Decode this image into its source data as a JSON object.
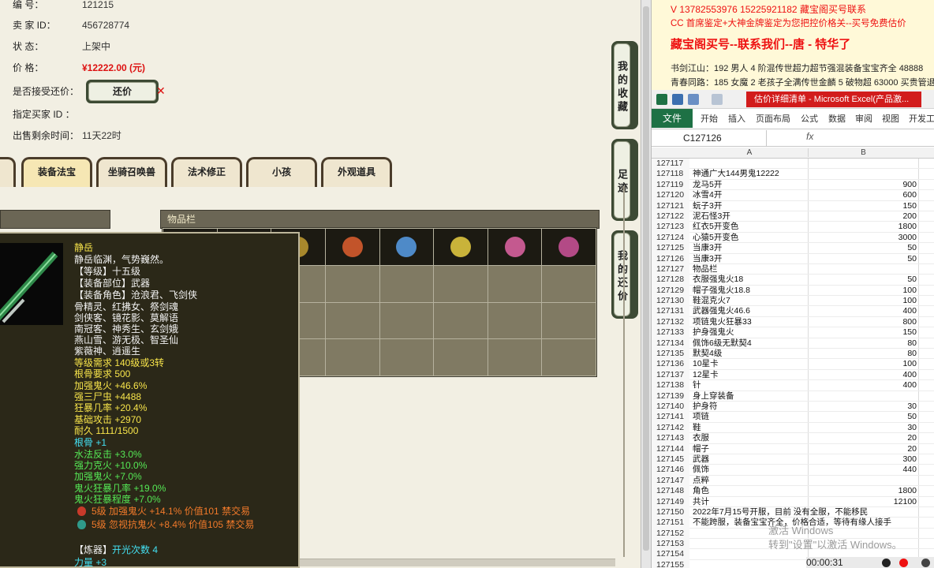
{
  "listing": {
    "serial_label": "编      号：",
    "serial_value": "121215",
    "seller_label": "卖  家  ID：",
    "seller_value": "456728774",
    "status_label": "状      态：",
    "status_value": "上架中",
    "price_label": "价      格：",
    "price_value": "¥12222.00 (元)",
    "counter_label": "是否接受还价：",
    "counter_button": "还价",
    "buyer_label": "指定买家 ID ：",
    "remaining_label": "出售剩余时间：",
    "remaining_value": "11天22时"
  },
  "tabs": [
    "装备法宝",
    "坐骑召唤兽",
    "法术修正",
    "小孩",
    "外观道具"
  ],
  "side_buttons": [
    "我的收藏",
    "足迹",
    "我的还价"
  ],
  "inventory_title": "物品栏",
  "item_colors": [
    "#3a6a3e",
    "#c9a040",
    "#a8882c",
    "#c2542a",
    "#4e8ac8",
    "#c9b33a",
    "#c4598f",
    "#b34a86"
  ],
  "tooltip": {
    "name": "静岳",
    "desc": "静岳临渊，气势巍然。",
    "level": "【等级】十五级",
    "slot": "【装备部位】武器",
    "roles": "【装备角色】沧浪君、飞剑侠",
    "roles_2": "骨精灵、红拂女、祭剑魂",
    "roles_3": "剑侠客、镜花影、莫解语",
    "roles_4": "南冠客、神秀生、玄剑娥",
    "roles_5": "燕山雪、游无极、智圣仙",
    "roles_6": "紫薇神、逍遥生",
    "req_level": "等级需求 140级或3转",
    "req_bone": "根骨要求 500",
    "stat_1": "加强鬼火 +46.6%",
    "stat_2": "强三尸虫 +4488",
    "stat_3": "狂暴几率 +20.4%",
    "stat_4": "基础攻击 +2970",
    "stat_5": "耐久 1111/1500",
    "bone": "根骨 +1",
    "bonus_1": "水法反击 +3.0%",
    "bonus_2": "强力克火 +10.0%",
    "bonus_3": "加强鬼火 +7.0%",
    "bonus_4": "鬼火狂暴几率 +19.0%",
    "bonus_5": "鬼火狂暴程度 +7.0%",
    "gem_1": "5级 加强鬼火 +14.1% 价值101 禁交易",
    "gem_2": "5级 忽视抗鬼火 +8.4% 价值105 禁交易",
    "refine_label": "【炼器】",
    "refine_value": "开光次数 4",
    "last_line": "力量 +3"
  },
  "ads": {
    "line_1": "V 13782553976     15225921182    藏宝阁买号联系",
    "line_2": "CC 首席鉴定+大神金牌鉴定为您把控价格关--买号免费估价",
    "line_3": "藏宝阁买号--联系我们--唐 - 特华了",
    "line_4": "书剑江山：192 男人 4 阶混传世超力超节强混装备宝宝齐全 48888",
    "line_5": "青春同路：185 女魔 2 老孩子全满传世金麟 5 破物超 63000 买贵管退"
  },
  "excel": {
    "title": "估价详细清单 - Microsoft Excel(产品激...",
    "file_tab": "文件",
    "ribbon_tabs": [
      "开始",
      "插入",
      "页面布局",
      "公式",
      "数据",
      "审阅",
      "视图",
      "开发工"
    ],
    "name_box": "C127126",
    "fx": "fx",
    "col_a": "A",
    "col_b": "B",
    "rows": [
      [
        "127117",
        "",
        ""
      ],
      [
        "127118",
        "神通广大144男鬼12222",
        ""
      ],
      [
        "127119",
        "龙马5开",
        "900"
      ],
      [
        "127120",
        "冰雪4开",
        "600"
      ],
      [
        "127121",
        "蚖子3开",
        "150"
      ],
      [
        "127122",
        "泥石怪3开",
        "200"
      ],
      [
        "127123",
        "红衣5开变色",
        "1800"
      ],
      [
        "127124",
        "心猿5开变色",
        "3000"
      ],
      [
        "127125",
        "当康3开",
        "50"
      ],
      [
        "127126",
        "当康3开",
        "50"
      ],
      [
        "127127",
        "物品栏",
        ""
      ],
      [
        "127128",
        "衣服强鬼火18",
        "50"
      ],
      [
        "127129",
        "帽子强鬼火18.8",
        "100"
      ],
      [
        "127130",
        "鞋混克火7",
        "100"
      ],
      [
        "127131",
        "武器强鬼火46.6",
        "400"
      ],
      [
        "127132",
        "项链鬼火狂暴33",
        "800"
      ],
      [
        "127133",
        "护身强鬼火",
        "150"
      ],
      [
        "127134",
        "佩饰6级无默契4",
        "80"
      ],
      [
        "127135",
        "默契4级",
        "80"
      ],
      [
        "127136",
        "10星卡",
        "100"
      ],
      [
        "127137",
        "12星卡",
        "400"
      ],
      [
        "127138",
        "针",
        "400"
      ],
      [
        "127139",
        "身上穿装备",
        ""
      ],
      [
        "127140",
        "护身符",
        "30"
      ],
      [
        "127141",
        "项链",
        "50"
      ],
      [
        "127142",
        "鞋",
        "30"
      ],
      [
        "127143",
        "衣服",
        "20"
      ],
      [
        "127144",
        "帽子",
        "20"
      ],
      [
        "127145",
        "武器",
        "300"
      ],
      [
        "127146",
        "佩饰",
        "440"
      ],
      [
        "127147",
        "点粹",
        ""
      ],
      [
        "127148",
        "角色",
        "1800"
      ],
      [
        "127149",
        "共计",
        "12100"
      ],
      [
        "127150",
        "2022年7月15号开服，目前 没有全服，不能移民",
        ""
      ],
      [
        "127151",
        "不能跨服，装备宝宝齐全，价格合适，等待有缘人接手",
        ""
      ],
      [
        "127152",
        "",
        ""
      ],
      [
        "127153",
        "",
        ""
      ],
      [
        "127154",
        "",
        ""
      ],
      [
        "127155",
        "",
        ""
      ]
    ]
  },
  "watermark": {
    "line_1": "激活 Windows",
    "line_2": "转到\"设置\"以激活 Windows。"
  },
  "recorder": {
    "time": "00:00:31"
  }
}
